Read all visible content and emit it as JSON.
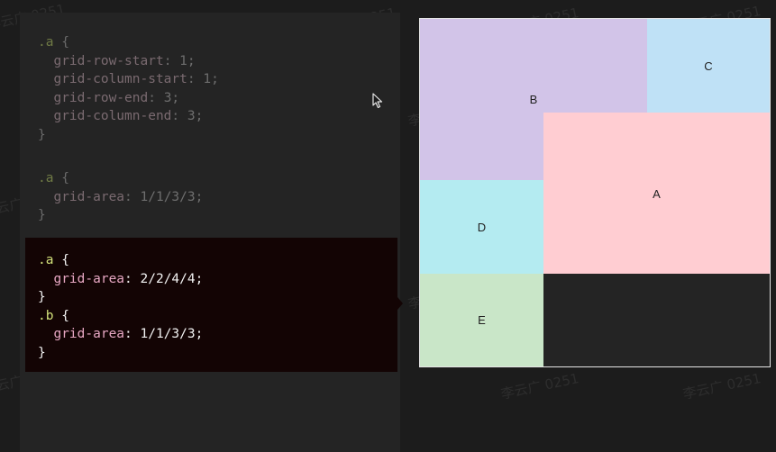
{
  "code": {
    "block1": {
      "selector": ".a",
      "open": " {",
      "props": [
        {
          "name": "grid-row-start",
          "value": "1;"
        },
        {
          "name": "grid-column-start",
          "value": "1;"
        },
        {
          "name": "grid-row-end",
          "value": "3;"
        },
        {
          "name": "grid-column-end",
          "value": "3;"
        }
      ],
      "close": "}"
    },
    "block2": {
      "selector": ".a",
      "open": " {",
      "props": [
        {
          "name": "grid-area",
          "value": "1/1/3/3;"
        }
      ],
      "close": "}"
    },
    "active": {
      "rule_a": {
        "selector": ".a",
        "open": " {",
        "prop": "grid-area",
        "value": "2/2/4/4;",
        "close": "}"
      },
      "rule_b": {
        "selector": ".b",
        "open": " {",
        "prop": "grid-area",
        "value": "1/1/3/3;",
        "close": "}"
      }
    }
  },
  "grid": {
    "cells": [
      {
        "label": "B",
        "color": "#d2c4e8"
      },
      {
        "label": "C",
        "color": "#bfe1f6"
      },
      {
        "label": "A",
        "color": "#ffcdd2"
      },
      {
        "label": "D",
        "color": "#b4ebf1"
      },
      {
        "label": "E",
        "color": "#c9e6c8"
      }
    ]
  },
  "watermark": "李云广 0251"
}
